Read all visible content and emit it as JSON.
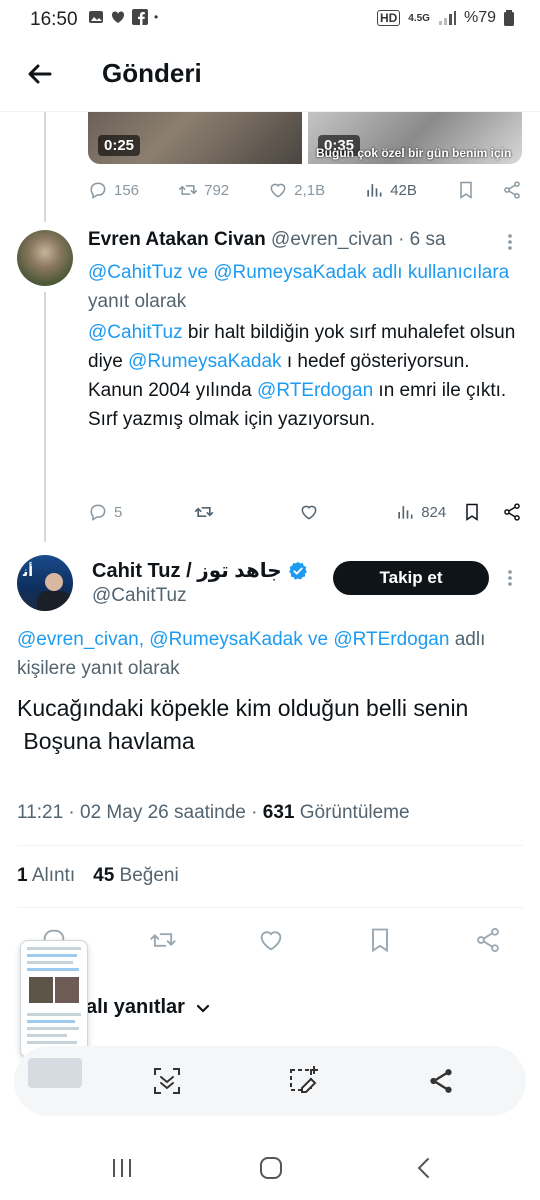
{
  "status_bar": {
    "time": "16:50",
    "battery": "%79",
    "network": "4.5G"
  },
  "header": {
    "title": "Gönderi"
  },
  "top_tweet": {
    "videos": [
      {
        "duration": "0:25"
      },
      {
        "duration": "0:35",
        "caption": "Bugün çok özel bir gün benim için"
      }
    ],
    "stats": {
      "replies": "156",
      "retweets": "792",
      "likes": "2,1B",
      "views": "42B"
    }
  },
  "reply_tweet": {
    "display_name": "Evren Atakan Civan",
    "handle": "@evren_civan",
    "time_ago": "· 6 sa",
    "reply_prefix_1": "@CahitTuz",
    "reply_prefix_and": "ve",
    "reply_prefix_2": "@RumeysaKadak adlı kullanıcılara",
    "reply_suffix": "yanıt olarak",
    "line1_mention": "@CahitTuz",
    "line1_text": "bir halt bildiğin yok sırf muhalefet olsun diye",
    "line2_mention": "@RumeysaKadak",
    "line2_text": "ı hedef gösteriyorsun.",
    "line3_pre": "Kanun 2004 yılında",
    "line3_mention": "@RTErdogan",
    "line3_post": "ın emri ile çıktı.",
    "line4": "Sırf yazmış olmak için yazıyorsun.",
    "stats": {
      "replies": "5",
      "views": "824"
    }
  },
  "main_tweet": {
    "display_name": "Cahit Tuz / جاهد توز",
    "handle": "@CahitTuz",
    "follow_label": "Takip et",
    "reply_mentions": "@evren_civan, @RumeysaKadak ve @RTErdogan",
    "reply_tail": "adlı kişilere yanıt olarak",
    "text_line1": "Kucağındaki köpekle kim olduğun belli senin",
    "text_line2": " Boşuna havlama",
    "timestamp": "11:21 · 02 May 26 saatinde ·",
    "view_count": "631",
    "view_label": "Görüntüleme",
    "quote_count": "1",
    "quote_label": "Alıntı",
    "like_count": "45",
    "like_label": "Beğeni",
    "replies_header": "alı yanıtlar"
  },
  "colors": {
    "link": "#1d9bf0",
    "muted": "#536471",
    "text": "#0f1419",
    "verified": "#1d9bf0"
  }
}
